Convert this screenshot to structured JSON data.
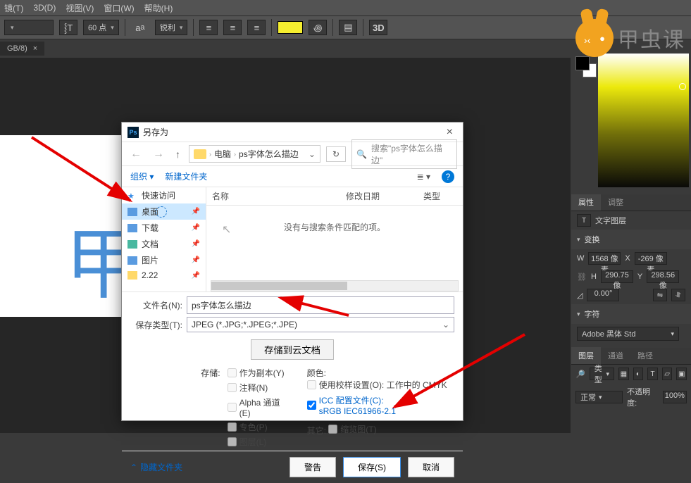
{
  "menu": {
    "items": [
      "镜(T)",
      "3D(D)",
      "视图(V)",
      "窗口(W)",
      "帮助(H)"
    ]
  },
  "optbar": {
    "font_size": "60 点",
    "aa": "锐利",
    "threeD": "3D"
  },
  "tab": {
    "label": "GB/8)",
    "close": "×"
  },
  "canvas": {
    "glyph": "甲"
  },
  "dialog": {
    "title": "另存为",
    "breadcrumb": {
      "root": "电脑",
      "folder": "ps字体怎么描边"
    },
    "search_placeholder": "搜索\"ps字体怎么描边\"",
    "organize": "组织",
    "new_folder": "新建文件夹",
    "sidebar": [
      {
        "icon": "star",
        "label": "快速访问",
        "pin": false
      },
      {
        "icon": "blue",
        "label": "桌面",
        "pin": true,
        "selected": true
      },
      {
        "icon": "blue",
        "label": "下载",
        "pin": true
      },
      {
        "icon": "teal",
        "label": "文档",
        "pin": true
      },
      {
        "icon": "blue",
        "label": "图片",
        "pin": true
      },
      {
        "icon": "yfold",
        "label": "2.22",
        "pin": true
      }
    ],
    "cols": {
      "name": "名称",
      "date": "修改日期",
      "type": "类型"
    },
    "empty": "没有与搜索条件匹配的项。",
    "fn_label": "文件名(N):",
    "fn_value": "ps字体怎么描边",
    "ft_label": "保存类型(T):",
    "ft_value": "JPEG (*.JPG;*.JPEG;*.JPE)",
    "cloud": "存储到云文档",
    "store": "存储:",
    "opts_store": [
      "作为副本(Y)",
      "注释(N)",
      "Alpha 通道(E)",
      "专色(P)",
      "图层(L)"
    ],
    "color_lbl": "颜色:",
    "color_opt": "使用校样设置(O): 工作中的 CMYK",
    "icc": "ICC 配置文件(C):",
    "icc_v": "sRGB IEC61966-2.1",
    "other_lbl": "其它:",
    "other_opt": "缩览图(T)",
    "hide": "隐藏文件夹",
    "warn": "警告",
    "save": "保存(S)",
    "cancel": "取消"
  },
  "right": {
    "props": "属性",
    "adjust": "调整",
    "text_layer": "文字图层",
    "transform": "变换",
    "W": "W",
    "H": "H",
    "X": "X",
    "Y": "Y",
    "w_val": "1568 像素",
    "x_val": "-269 像素",
    "h_val": "290.75 像",
    "y_val": "298.56 像",
    "angle": "0.00°",
    "char": "字符",
    "font": "Adobe 黑体 Std",
    "layers": "图层",
    "channels": "通道",
    "paths": "路径",
    "kind": "类型",
    "normal": "正常",
    "opacity": "不透明度:",
    "opv": "100%"
  },
  "logo": {
    "text": "甲虫课"
  }
}
